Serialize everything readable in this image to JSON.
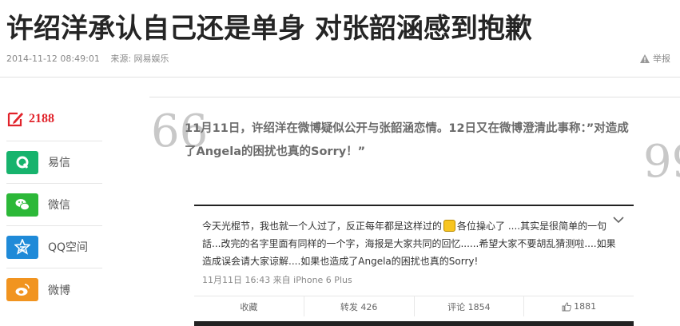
{
  "article": {
    "title": "许绍洋承认自己还是单身 对张韶涵感到抱歉",
    "date": "2014-11-12 08:49:01",
    "source": "来源: 网易娱乐",
    "report_label": "举报"
  },
  "share": {
    "comment_count": "2188",
    "items": [
      {
        "label": "易信",
        "icon": "yixin-icon",
        "color": "#17b36d"
      },
      {
        "label": "微信",
        "icon": "wechat-icon",
        "color": "#2cb838"
      },
      {
        "label": "QQ空间",
        "icon": "qzone-icon",
        "color": "#1f8ad8"
      },
      {
        "label": "微博",
        "icon": "weibo-icon",
        "color": "#f19420"
      }
    ]
  },
  "quote": {
    "open_mark": "66",
    "close_mark": "99",
    "text": "11月11日，许绍洋在微博疑似公开与张韶涵恋情。12日又在微博澄清此事称：”对造成了Angela的困扰也真的Sorry！”"
  },
  "weibo": {
    "text_before_emoji": "今天光棍节，我也就一个人过了，反正每年都是这样过的",
    "text_after_emoji": "各位操心了 ....其实是很简单的一句話...改完的名字里面有同样的一个字，海报是大家共同的回忆......希望大家不要胡乱猜测啦....如果造成误会请大家谅解....如果也造成了Angela的困扰也真的Sorry!",
    "time": "11月11日 16:43 来自 iPhone 6 Plus",
    "actions": {
      "favorite": "收藏",
      "repost": "转发 426",
      "comment": "评论 1854",
      "like": "1881"
    }
  },
  "colors": {
    "accent_red": "#e1232b",
    "text_dark": "#252525",
    "quote_gray": "#6b6b6b"
  }
}
